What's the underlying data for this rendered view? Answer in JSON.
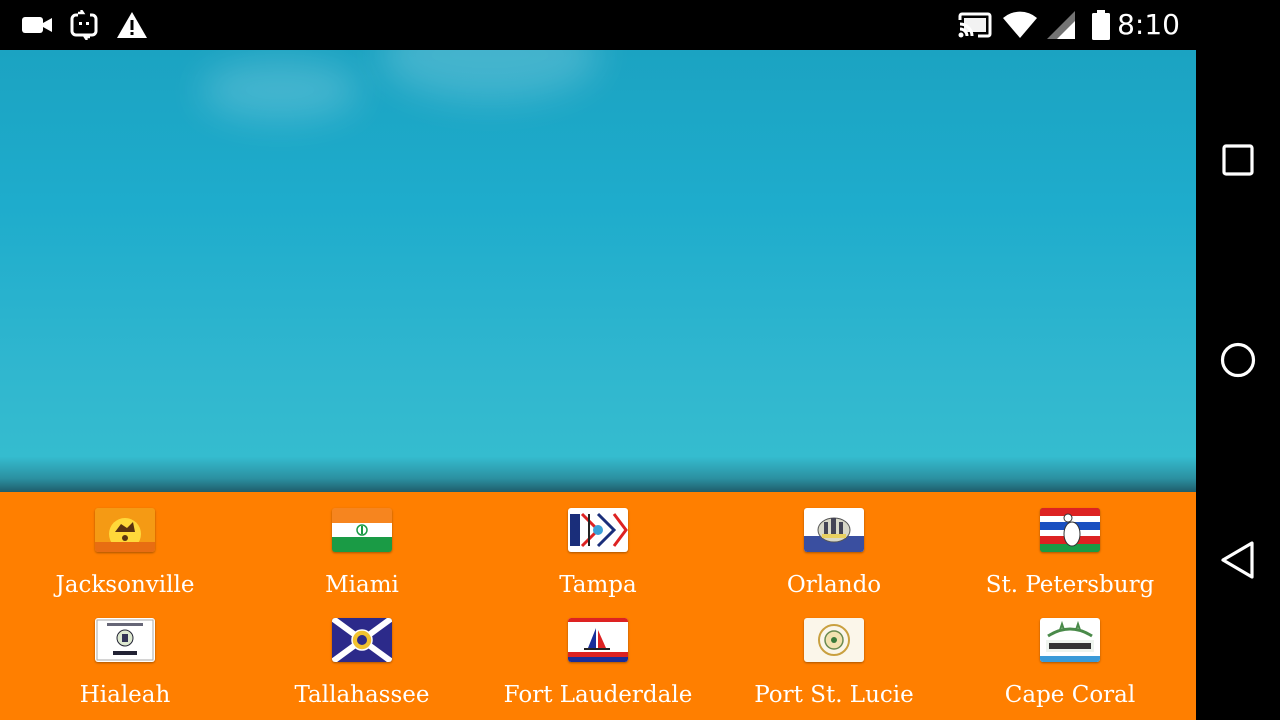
{
  "status_bar": {
    "time": "8:10",
    "left_icons": [
      "video-camera-icon",
      "screen-record-icon",
      "warning-icon"
    ],
    "right_icons": [
      "cast-icon",
      "wifi-icon",
      "signal-icon",
      "battery-icon"
    ]
  },
  "navigation_bar": {
    "buttons": [
      "recent-apps",
      "home",
      "back"
    ]
  },
  "colors": {
    "accent": "#ff7f00",
    "hero_sky": "#1eaccc",
    "label": "#ffffff"
  },
  "cities": [
    {
      "label": "Jacksonville",
      "icon": "jacksonville-flag-icon"
    },
    {
      "label": "Miami",
      "icon": "miami-flag-icon"
    },
    {
      "label": "Tampa",
      "icon": "tampa-flag-icon"
    },
    {
      "label": "Orlando",
      "icon": "orlando-flag-icon"
    },
    {
      "label": "St. Petersburg",
      "icon": "st-petersburg-flag-icon"
    },
    {
      "label": "Hialeah",
      "icon": "hialeah-flag-icon"
    },
    {
      "label": "Tallahassee",
      "icon": "tallahassee-flag-icon"
    },
    {
      "label": "Fort Lauderdale",
      "icon": "fort-lauderdale-flag-icon"
    },
    {
      "label": "Port St. Lucie",
      "icon": "port-st-lucie-flag-icon"
    },
    {
      "label": "Cape Coral",
      "icon": "cape-coral-flag-icon"
    }
  ]
}
